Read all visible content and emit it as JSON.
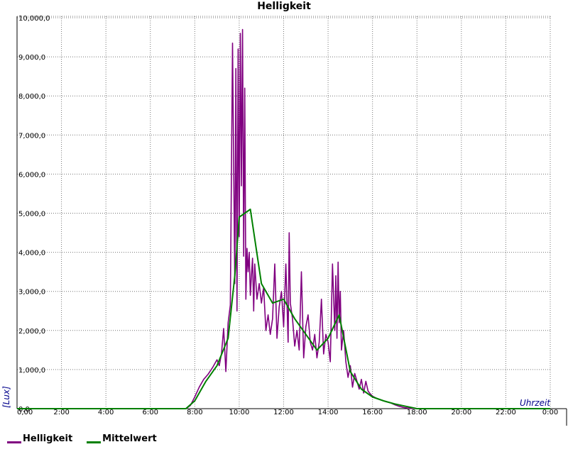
{
  "chart_data": {
    "type": "line",
    "title": "Helligkeit",
    "xlabel": "Uhrzeit",
    "ylabel": "[Lux]",
    "xlim": [
      0,
      24
    ],
    "ylim": [
      0,
      10000
    ],
    "grid": true,
    "legend_position": "bottom-left",
    "x_tick_labels": [
      "0,00",
      "2:00",
      "4:00",
      "6:00",
      "8:00",
      "10:00",
      "12:00",
      "14:00",
      "16:00",
      "18:00",
      "20:00",
      "22:00",
      "0:00"
    ],
    "y_tick_labels": [
      "0,0",
      "1,000,0",
      "2,000,0",
      "3,000,0",
      "4,000,0",
      "5,000,0",
      "6,000,0",
      "7,000,0",
      "8,000,0",
      "9,000,0",
      "10,000,0"
    ],
    "series": [
      {
        "name": "Helligkeit",
        "color": "#800080",
        "x": [
          0,
          7.6,
          7.8,
          8.0,
          8.2,
          8.4,
          8.6,
          8.8,
          9.0,
          9.1,
          9.2,
          9.3,
          9.4,
          9.5,
          9.6,
          9.7,
          9.8,
          9.85,
          9.9,
          9.95,
          10.0,
          10.05,
          10.1,
          10.15,
          10.2,
          10.25,
          10.3,
          10.35,
          10.4,
          10.45,
          10.5,
          10.55,
          10.6,
          10.65,
          10.7,
          10.8,
          10.9,
          11.0,
          11.1,
          11.2,
          11.3,
          11.4,
          11.5,
          11.6,
          11.7,
          11.8,
          11.9,
          12.0,
          12.1,
          12.2,
          12.25,
          12.3,
          12.4,
          12.5,
          12.6,
          12.7,
          12.8,
          12.9,
          13.0,
          13.1,
          13.2,
          13.3,
          13.4,
          13.5,
          13.6,
          13.7,
          13.8,
          13.9,
          14.0,
          14.1,
          14.2,
          14.3,
          14.35,
          14.4,
          14.45,
          14.5,
          14.55,
          14.6,
          14.7,
          14.8,
          14.9,
          15.0,
          15.1,
          15.2,
          15.3,
          15.4,
          15.5,
          15.6,
          15.7,
          15.8,
          15.9,
          16.0,
          16.2,
          16.4,
          16.6,
          16.8,
          17.0,
          17.2,
          17.4,
          17.6,
          17.8,
          18.0,
          24
        ],
        "values": [
          0,
          0,
          80,
          300,
          550,
          750,
          880,
          1050,
          1250,
          1100,
          1400,
          2050,
          950,
          2200,
          2650,
          9350,
          3200,
          8700,
          2500,
          9200,
          4400,
          9600,
          5700,
          9700,
          3900,
          8200,
          2800,
          4100,
          3500,
          4000,
          2900,
          3400,
          3850,
          2500,
          3700,
          2800,
          3200,
          2700,
          3100,
          2000,
          2400,
          1900,
          2300,
          3700,
          1800,
          2600,
          3000,
          2100,
          3700,
          1700,
          4500,
          2700,
          2300,
          1600,
          2000,
          1500,
          3500,
          1300,
          2100,
          2400,
          1700,
          1500,
          1900,
          1300,
          1700,
          2800,
          1400,
          1900,
          1700,
          1200,
          3700,
          2000,
          3400,
          1800,
          3750,
          2200,
          3000,
          1500,
          2000,
          1200,
          800,
          1100,
          550,
          900,
          700,
          500,
          750,
          400,
          700,
          450,
          380,
          320,
          260,
          220,
          180,
          150,
          100,
          60,
          30,
          15,
          5,
          0,
          0
        ]
      },
      {
        "name": "Mittelwert",
        "color": "#008000",
        "x": [
          0,
          7.6,
          8.0,
          8.5,
          9.0,
          9.5,
          9.8,
          10.0,
          10.5,
          11.0,
          11.5,
          12.0,
          12.5,
          13.0,
          13.5,
          14.0,
          14.5,
          15.0,
          15.5,
          16.0,
          16.5,
          17.0,
          17.5,
          18.0,
          24
        ],
        "values": [
          0,
          0,
          200,
          700,
          1100,
          1800,
          3400,
          4900,
          5100,
          3200,
          2700,
          2800,
          2300,
          1900,
          1500,
          1800,
          2400,
          950,
          500,
          300,
          200,
          120,
          60,
          0,
          0
        ]
      }
    ]
  }
}
